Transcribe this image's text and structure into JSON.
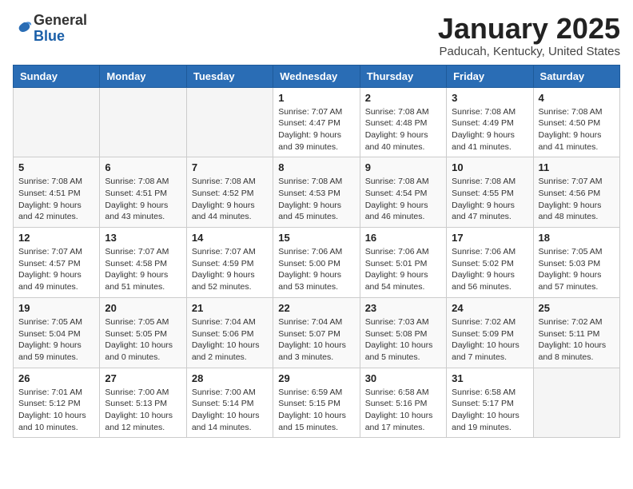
{
  "logo": {
    "general": "General",
    "blue": "Blue"
  },
  "header": {
    "month": "January 2025",
    "location": "Paducah, Kentucky, United States"
  },
  "weekdays": [
    "Sunday",
    "Monday",
    "Tuesday",
    "Wednesday",
    "Thursday",
    "Friday",
    "Saturday"
  ],
  "weeks": [
    [
      {
        "day": "",
        "info": ""
      },
      {
        "day": "",
        "info": ""
      },
      {
        "day": "",
        "info": ""
      },
      {
        "day": "1",
        "info": "Sunrise: 7:07 AM\nSunset: 4:47 PM\nDaylight: 9 hours\nand 39 minutes."
      },
      {
        "day": "2",
        "info": "Sunrise: 7:08 AM\nSunset: 4:48 PM\nDaylight: 9 hours\nand 40 minutes."
      },
      {
        "day": "3",
        "info": "Sunrise: 7:08 AM\nSunset: 4:49 PM\nDaylight: 9 hours\nand 41 minutes."
      },
      {
        "day": "4",
        "info": "Sunrise: 7:08 AM\nSunset: 4:50 PM\nDaylight: 9 hours\nand 41 minutes."
      }
    ],
    [
      {
        "day": "5",
        "info": "Sunrise: 7:08 AM\nSunset: 4:51 PM\nDaylight: 9 hours\nand 42 minutes."
      },
      {
        "day": "6",
        "info": "Sunrise: 7:08 AM\nSunset: 4:51 PM\nDaylight: 9 hours\nand 43 minutes."
      },
      {
        "day": "7",
        "info": "Sunrise: 7:08 AM\nSunset: 4:52 PM\nDaylight: 9 hours\nand 44 minutes."
      },
      {
        "day": "8",
        "info": "Sunrise: 7:08 AM\nSunset: 4:53 PM\nDaylight: 9 hours\nand 45 minutes."
      },
      {
        "day": "9",
        "info": "Sunrise: 7:08 AM\nSunset: 4:54 PM\nDaylight: 9 hours\nand 46 minutes."
      },
      {
        "day": "10",
        "info": "Sunrise: 7:08 AM\nSunset: 4:55 PM\nDaylight: 9 hours\nand 47 minutes."
      },
      {
        "day": "11",
        "info": "Sunrise: 7:07 AM\nSunset: 4:56 PM\nDaylight: 9 hours\nand 48 minutes."
      }
    ],
    [
      {
        "day": "12",
        "info": "Sunrise: 7:07 AM\nSunset: 4:57 PM\nDaylight: 9 hours\nand 49 minutes."
      },
      {
        "day": "13",
        "info": "Sunrise: 7:07 AM\nSunset: 4:58 PM\nDaylight: 9 hours\nand 51 minutes."
      },
      {
        "day": "14",
        "info": "Sunrise: 7:07 AM\nSunset: 4:59 PM\nDaylight: 9 hours\nand 52 minutes."
      },
      {
        "day": "15",
        "info": "Sunrise: 7:06 AM\nSunset: 5:00 PM\nDaylight: 9 hours\nand 53 minutes."
      },
      {
        "day": "16",
        "info": "Sunrise: 7:06 AM\nSunset: 5:01 PM\nDaylight: 9 hours\nand 54 minutes."
      },
      {
        "day": "17",
        "info": "Sunrise: 7:06 AM\nSunset: 5:02 PM\nDaylight: 9 hours\nand 56 minutes."
      },
      {
        "day": "18",
        "info": "Sunrise: 7:05 AM\nSunset: 5:03 PM\nDaylight: 9 hours\nand 57 minutes."
      }
    ],
    [
      {
        "day": "19",
        "info": "Sunrise: 7:05 AM\nSunset: 5:04 PM\nDaylight: 9 hours\nand 59 minutes."
      },
      {
        "day": "20",
        "info": "Sunrise: 7:05 AM\nSunset: 5:05 PM\nDaylight: 10 hours\nand 0 minutes."
      },
      {
        "day": "21",
        "info": "Sunrise: 7:04 AM\nSunset: 5:06 PM\nDaylight: 10 hours\nand 2 minutes."
      },
      {
        "day": "22",
        "info": "Sunrise: 7:04 AM\nSunset: 5:07 PM\nDaylight: 10 hours\nand 3 minutes."
      },
      {
        "day": "23",
        "info": "Sunrise: 7:03 AM\nSunset: 5:08 PM\nDaylight: 10 hours\nand 5 minutes."
      },
      {
        "day": "24",
        "info": "Sunrise: 7:02 AM\nSunset: 5:09 PM\nDaylight: 10 hours\nand 7 minutes."
      },
      {
        "day": "25",
        "info": "Sunrise: 7:02 AM\nSunset: 5:11 PM\nDaylight: 10 hours\nand 8 minutes."
      }
    ],
    [
      {
        "day": "26",
        "info": "Sunrise: 7:01 AM\nSunset: 5:12 PM\nDaylight: 10 hours\nand 10 minutes."
      },
      {
        "day": "27",
        "info": "Sunrise: 7:00 AM\nSunset: 5:13 PM\nDaylight: 10 hours\nand 12 minutes."
      },
      {
        "day": "28",
        "info": "Sunrise: 7:00 AM\nSunset: 5:14 PM\nDaylight: 10 hours\nand 14 minutes."
      },
      {
        "day": "29",
        "info": "Sunrise: 6:59 AM\nSunset: 5:15 PM\nDaylight: 10 hours\nand 15 minutes."
      },
      {
        "day": "30",
        "info": "Sunrise: 6:58 AM\nSunset: 5:16 PM\nDaylight: 10 hours\nand 17 minutes."
      },
      {
        "day": "31",
        "info": "Sunrise: 6:58 AM\nSunset: 5:17 PM\nDaylight: 10 hours\nand 19 minutes."
      },
      {
        "day": "",
        "info": ""
      }
    ]
  ]
}
